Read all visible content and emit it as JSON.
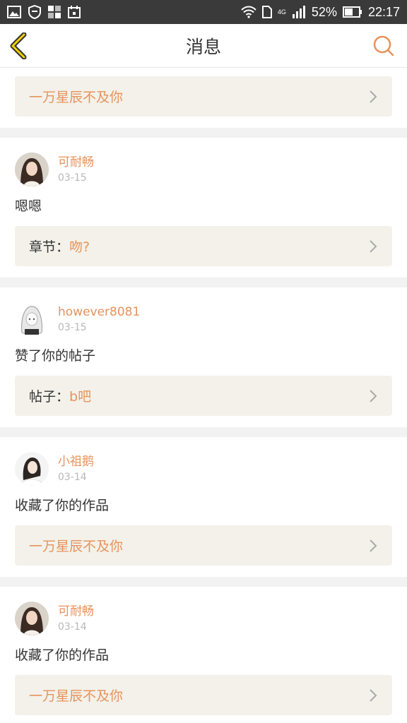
{
  "status_bar": {
    "battery": "52%",
    "time": "22:17",
    "network": "4G"
  },
  "header": {
    "title": "消息"
  },
  "colors": {
    "accent": "#e8925a",
    "link_bg": "#f3f1ea",
    "status_bar_bg": "#3a3a3a"
  },
  "messages": [
    {
      "link": {
        "prefix": "",
        "text": "一万星辰不及你"
      }
    },
    {
      "user": "可耐畅",
      "date": "03-15",
      "text": "嗯嗯",
      "link": {
        "prefix": "章节：",
        "text": "吻?"
      }
    },
    {
      "user": "however8081",
      "date": "03-15",
      "text": "赞了你的帖子",
      "link": {
        "prefix": "帖子：",
        "text": "b吧"
      }
    },
    {
      "user": "小祖鹅",
      "date": "03-14",
      "text": "收藏了你的作品",
      "link": {
        "prefix": "",
        "text": "一万星辰不及你"
      }
    },
    {
      "user": "可耐畅",
      "date": "03-14",
      "text": "收藏了你的作品",
      "link": {
        "prefix": "",
        "text": "一万星辰不及你"
      }
    }
  ]
}
